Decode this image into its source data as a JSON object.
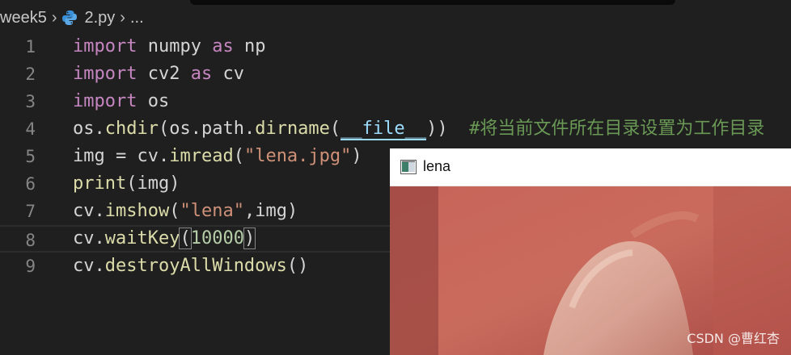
{
  "breadcrumb": {
    "folder": "week5",
    "file": "2.py",
    "more": "..."
  },
  "code": {
    "line_numbers": [
      "1",
      "2",
      "3",
      "4",
      "5",
      "6",
      "7",
      "8",
      "9"
    ],
    "l1": {
      "kw1": "import",
      "mod": " numpy ",
      "kw2": "as",
      "alias": " np"
    },
    "l2": {
      "kw1": "import",
      "mod": " cv2 ",
      "kw2": "as",
      "alias": " cv"
    },
    "l3": {
      "kw1": "import",
      "mod": " os"
    },
    "l4": {
      "p1": "os.",
      "f1": "chdir",
      "p2": "(os.path.",
      "f2": "dirname",
      "p3": "(",
      "dunder": "__file__",
      "p4": "))  ",
      "comment": "#将当前文件所在目录设置为工作目录"
    },
    "l5": {
      "p1": "img = cv.",
      "f1": "imread",
      "p2": "(",
      "s1": "\"lena.jpg\"",
      "p3": ")"
    },
    "l6": {
      "f1": "print",
      "p1": "(img)"
    },
    "l7": {
      "p1": "cv.",
      "f1": "imshow",
      "p2": "(",
      "s1": "\"lena\"",
      "p3": ",img)"
    },
    "l8": {
      "p1": "cv.",
      "f1": "waitKey",
      "b1": "(",
      "n1": "10000",
      "b2": ")"
    },
    "l9": {
      "p1": "cv.",
      "f1": "destroyAllWindows",
      "p2": "()"
    }
  },
  "window": {
    "title": "lena"
  },
  "watermark": "CSDN @曹红杏",
  "colors": {
    "keyword": "#c586c0",
    "string": "#ce9178",
    "function": "#dcdcaa",
    "number": "#b5cea8",
    "comment": "#6a9955",
    "background": "#1f1f1f"
  }
}
